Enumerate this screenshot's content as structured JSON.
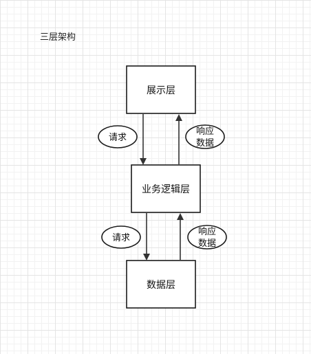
{
  "title": "三层架构",
  "layers": {
    "presentation": "展示层",
    "business": "业务逻辑层",
    "data": "数据层"
  },
  "annotations": {
    "request_top": "请求",
    "response_top_line1": "响应",
    "response_top_line2": "数据",
    "request_bottom": "请求",
    "response_bottom_line1": "响应",
    "response_bottom_line2": "数据"
  },
  "colors": {
    "stroke": "#1a1a1a",
    "fill": "#ffffff",
    "arrow": "#333333"
  }
}
